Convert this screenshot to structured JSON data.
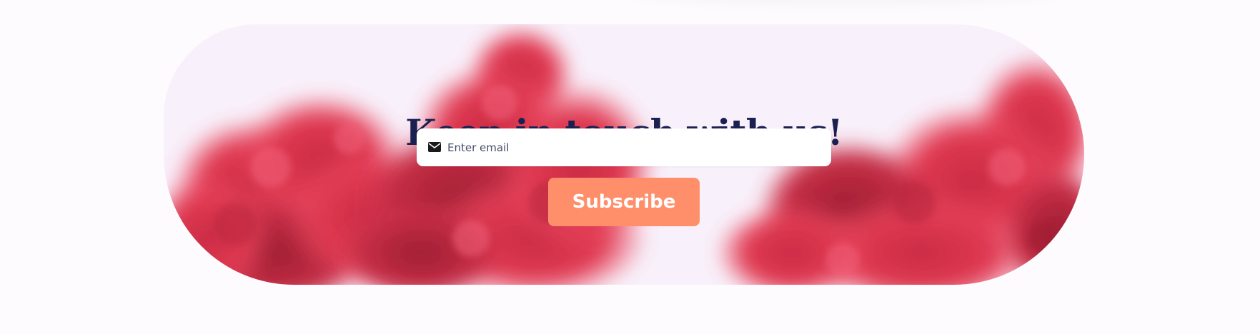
{
  "colors": {
    "heading": "#1c2050",
    "button": "#ff8f6b",
    "button_text": "#ffffff",
    "smoke": "#e03a52",
    "banner_bg": "#f8f1fb"
  },
  "newsletter": {
    "heading": "Keep in touch with us!",
    "email_icon": "envelope-icon",
    "email_placeholder": "Enter email",
    "email_value": "",
    "subscribe_label": "Subscribe"
  }
}
